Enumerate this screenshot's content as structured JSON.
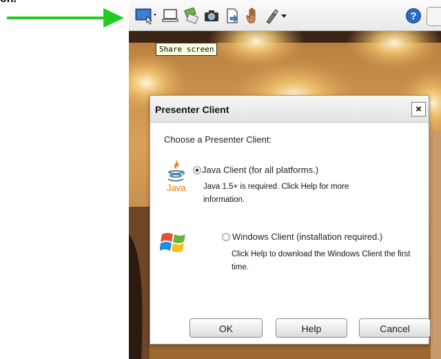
{
  "page": {
    "top_crop_text": "on."
  },
  "toolbar": {
    "icons": [
      {
        "name": "share-screen-icon"
      },
      {
        "name": "whiteboard-icon"
      },
      {
        "name": "share-application-icon"
      },
      {
        "name": "camera-icon"
      },
      {
        "name": "share-document-icon"
      },
      {
        "name": "hand-icon"
      },
      {
        "name": "pointer-tool-icon"
      },
      {
        "name": "help-icon"
      }
    ],
    "tooltip": "Share screen"
  },
  "dialog": {
    "title": "Presenter Client",
    "close_glyph": "×",
    "prompt": "Choose a Presenter Client:",
    "options": [
      {
        "label": "Java Client (for all platforms.)",
        "description": "Java 1.5+ is required. Click Help for more information.",
        "logo_text": "Java",
        "selected": true
      },
      {
        "label": "Windows Client (installation required.)",
        "description": "Click Help to download the Windows Client the first time.",
        "selected": false
      }
    ],
    "buttons": {
      "ok": "OK",
      "help": "Help",
      "cancel": "Cancel"
    }
  },
  "colors": {
    "arrow": "#22cc22",
    "java_red": "#e76f00",
    "java_blue": "#5382a1",
    "tooltip_bg": "#ffffe1"
  }
}
